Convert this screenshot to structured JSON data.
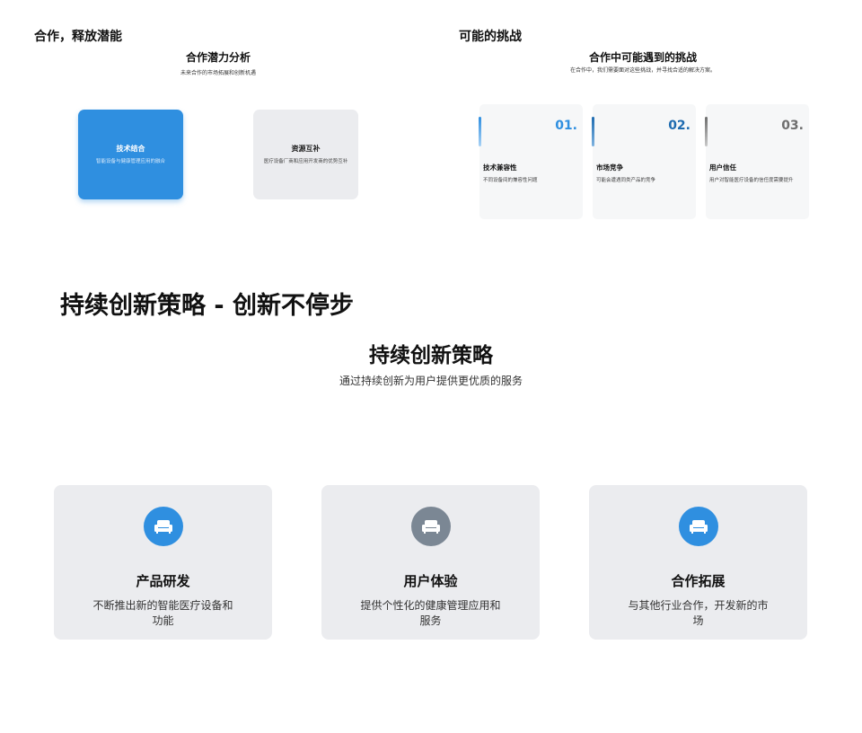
{
  "left_panel": {
    "title": "合作，释放潜能",
    "subtitle": "合作潜力分析",
    "desc": "未来合作的市场拓展和创新机遇",
    "cards": [
      {
        "title": "技术结合",
        "desc": "智能设备与健康管理应用的融合"
      },
      {
        "title": "资源互补",
        "desc": "医疗设备厂商和应用开发商的优势互补"
      }
    ]
  },
  "right_panel": {
    "title": "可能的挑战",
    "subtitle": "合作中可能遇到的挑战",
    "desc": "在合作中，我们需要面对这些挑战，并寻找合适的解决方案。",
    "cards": [
      {
        "num": "01.",
        "title": "技术兼容性",
        "desc": "不同设备间的兼容性问题",
        "color": "#2f8fe0"
      },
      {
        "num": "02.",
        "title": "市场竞争",
        "desc": "可能会遭遇同类产品的竞争",
        "color": "#1e6bb0"
      },
      {
        "num": "03.",
        "title": "用户信任",
        "desc": "用户对智能医疗设备的信任度需要提升",
        "color": "#6e6e6e"
      }
    ]
  },
  "bottom": {
    "heading": "持续创新策略 - 创新不停步",
    "title": "持续创新策略",
    "desc": "通过持续创新为用户提供更优质的服务",
    "features": [
      {
        "icon": "sofa-icon",
        "color": "#2f8fe0",
        "title": "产品研发",
        "desc": "不断推出新的智能医疗设备和功能"
      },
      {
        "icon": "sofa-icon",
        "color": "#7b8794",
        "title": "用户体验",
        "desc": "提供个性化的健康管理应用和服务"
      },
      {
        "icon": "sofa-icon",
        "color": "#2f8fe0",
        "title": "合作拓展",
        "desc": "与其他行业合作，开发新的市场"
      }
    ]
  }
}
